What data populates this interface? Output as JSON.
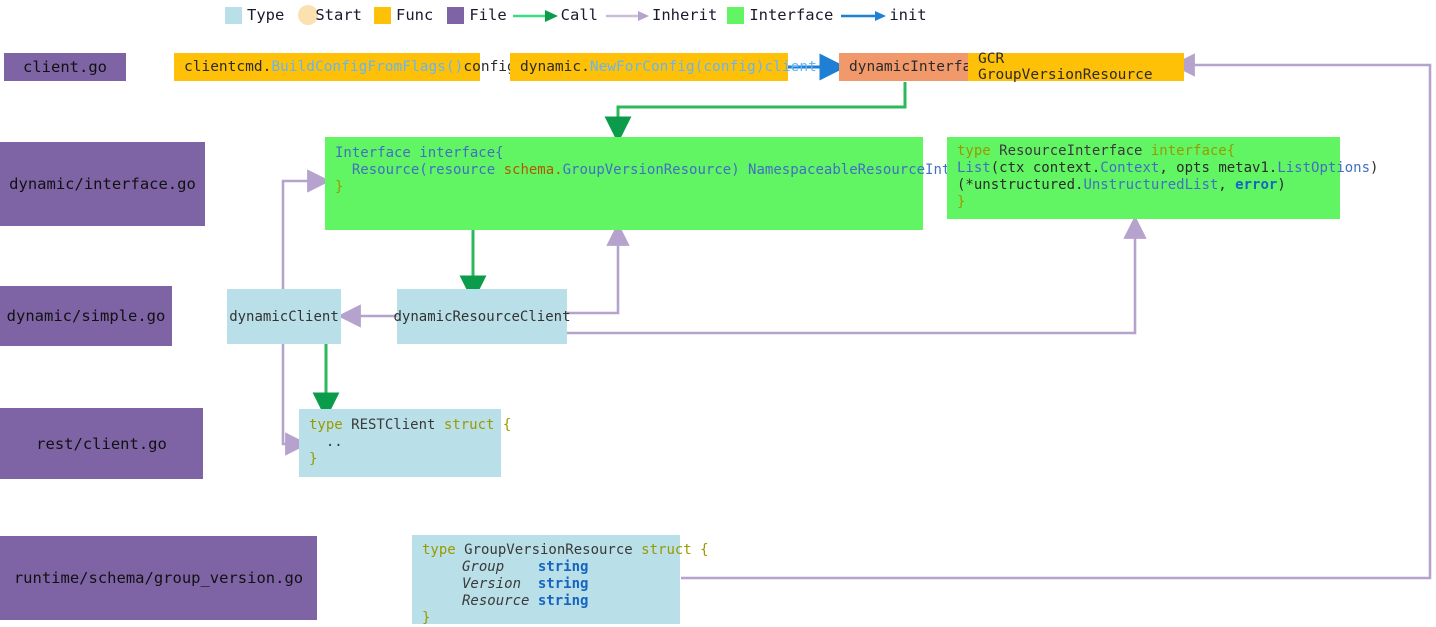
{
  "legend": {
    "items": [
      {
        "kind": "swatch",
        "icon": "type-swatch-icon",
        "label": "Type",
        "color": "#b9dfe8"
      },
      {
        "kind": "ellipse",
        "icon": "start-ellipse-icon",
        "label": "Start",
        "color": "#fbe0b0"
      },
      {
        "kind": "swatch",
        "icon": "func-swatch-icon",
        "label": "Func",
        "color": "#ffc107"
      },
      {
        "kind": "swatch",
        "icon": "file-swatch-icon",
        "label": "File",
        "color": "#7e64a5"
      },
      {
        "kind": "arrow",
        "icon": "call-arrow-icon",
        "label": "Call",
        "color": "#22b14c"
      },
      {
        "kind": "arrow",
        "icon": "inherit-arrow-icon",
        "label": "Inherit",
        "color": "#b5a3cd"
      },
      {
        "kind": "swatch",
        "icon": "interface-swatch-icon",
        "label": "Interface",
        "color": "#61f564"
      },
      {
        "kind": "arrow",
        "icon": "init-arrow-icon",
        "label": "init",
        "color": "#1e7fd4"
      }
    ]
  },
  "files": {
    "client": "client.go",
    "dynamic_interface": "dynamic/interface.go",
    "dynamic_simple": "dynamic/simple.go",
    "rest_client": "rest/client.go",
    "runtime_schema": "runtime/schema/group_version.go"
  },
  "funcs": {
    "build_config": {
      "pkg": "clientcmd.",
      "fn": "BuildConfigFromFlags()",
      "ret": " config"
    },
    "new_for_config": {
      "pkg": "dynamic.",
      "fn": "NewForConfig(config)",
      "ret": " client"
    },
    "dynamic_interface": "dynamicInterface",
    "gcr": "GCR GroupVersionResource"
  },
  "types": {
    "dynamic_client": "dynamicClient",
    "dynamic_resource_client": "dynamicResourceClient"
  },
  "interface_box": {
    "line1_a": "Interface",
    "line1_b": " interface{",
    "line2_a": "  Resource",
    "line2_b": "(resource ",
    "line2_c": "schema.",
    "line2_d": "GroupVersionResource",
    "line2_e": ") ",
    "line2_f": "NamespaceableResourceInterface",
    "line3": "}"
  },
  "resource_interface_box": {
    "l1_type": "type",
    "l1_name": " ResourceInterface ",
    "l1_kw": "interface{",
    "l2_a": "List",
    "l2_b": "(ctx context.",
    "l2_c": "Context",
    "l2_d": ", opts metav1.",
    "l2_e": "ListOptions",
    "l2_f": ")",
    "l3_a": "(*unstructured.",
    "l3_b": "UnstructuredList",
    "l3_c": ", ",
    "l3_d": "error",
    "l3_e": ")",
    "l4": "}"
  },
  "rest_client_box": {
    "l1_type": "type",
    "l1_name": " RESTClient ",
    "l1_kw": "struct {",
    "l2": "  ..",
    "l3": "}"
  },
  "gvr_box": {
    "l1_type": "type",
    "l1_name": " GroupVersionResource ",
    "l1_kw": "struct {",
    "fields": [
      {
        "name": "Group",
        "type": "string"
      },
      {
        "name": "Version",
        "type": "string"
      },
      {
        "name": "Resource",
        "type": "string"
      }
    ],
    "close": "}"
  },
  "colors": {
    "file": "#7e64a5",
    "func": "#ffc107",
    "start": "#f2996b",
    "type": "#b9dfe8",
    "interface": "#61f564",
    "call_arrow": "#22b14c",
    "call_line": "#2eb85c",
    "inherit": "#b5a3cd",
    "init": "#1e7fd4"
  }
}
